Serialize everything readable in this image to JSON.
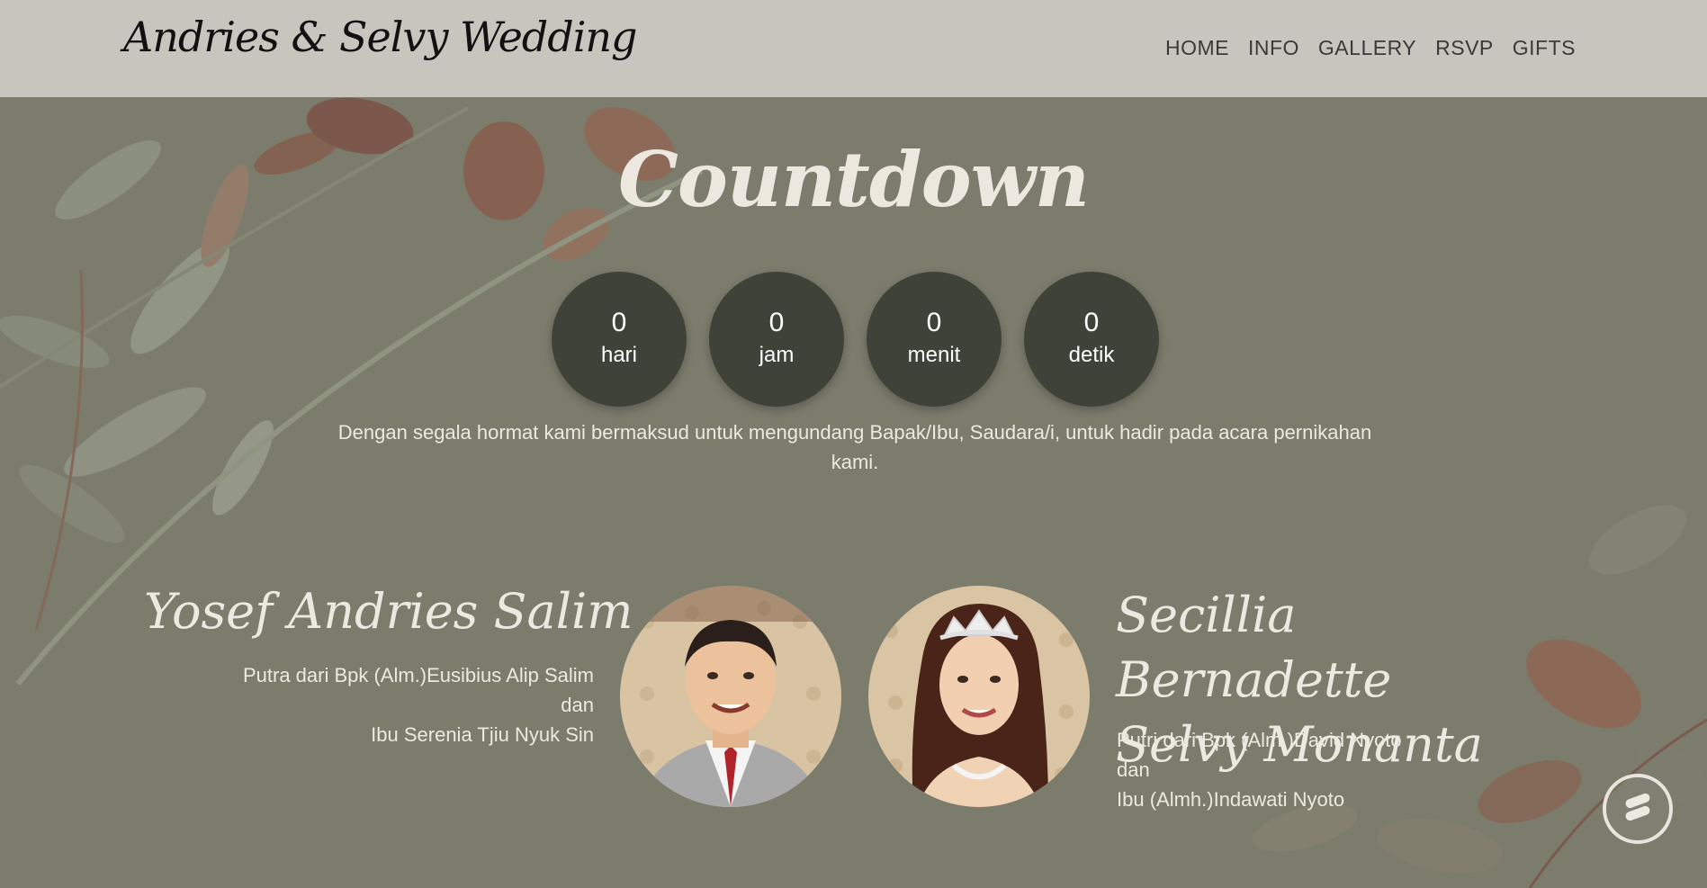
{
  "navbar": {
    "brand": "Andries & Selvy Wedding",
    "links": [
      "HOME",
      "INFO",
      "GALLERY",
      "RSVP",
      "GIFTS"
    ]
  },
  "countdown": {
    "title": "Countdown",
    "units": [
      {
        "value": "0",
        "label": "hari"
      },
      {
        "value": "0",
        "label": "jam"
      },
      {
        "value": "0",
        "label": "menit"
      },
      {
        "value": "0",
        "label": "detik"
      }
    ]
  },
  "invitation": "Dengan segala hormat kami bermaksud untuk mengundang Bapak/Ibu, Saudara/i, untuk hadir pada acara pernikahan kami.",
  "groom": {
    "name": "Yosef Andries Salim",
    "parents_line1": "Putra dari Bpk (Alm.)Eusibius Alip Salim",
    "parents_line2": "dan",
    "parents_line3": "Ibu Serenia Tjiu Nyuk Sin"
  },
  "bride": {
    "name": "Secillia Bernadette Selvy Monanta",
    "parents_line1": "Putri dari Bpk (Alm.)David Nyoto",
    "parents_line2": "dan",
    "parents_line3": "Ibu (Almh.)Indawati Nyoto"
  },
  "colors": {
    "background": "#7c7c6d",
    "navbar": "#cdcbc6",
    "countdown_circle": "#3e4238",
    "text_light": "#ece9e1"
  },
  "icons": {
    "chat": "chat-bubble-icon"
  }
}
